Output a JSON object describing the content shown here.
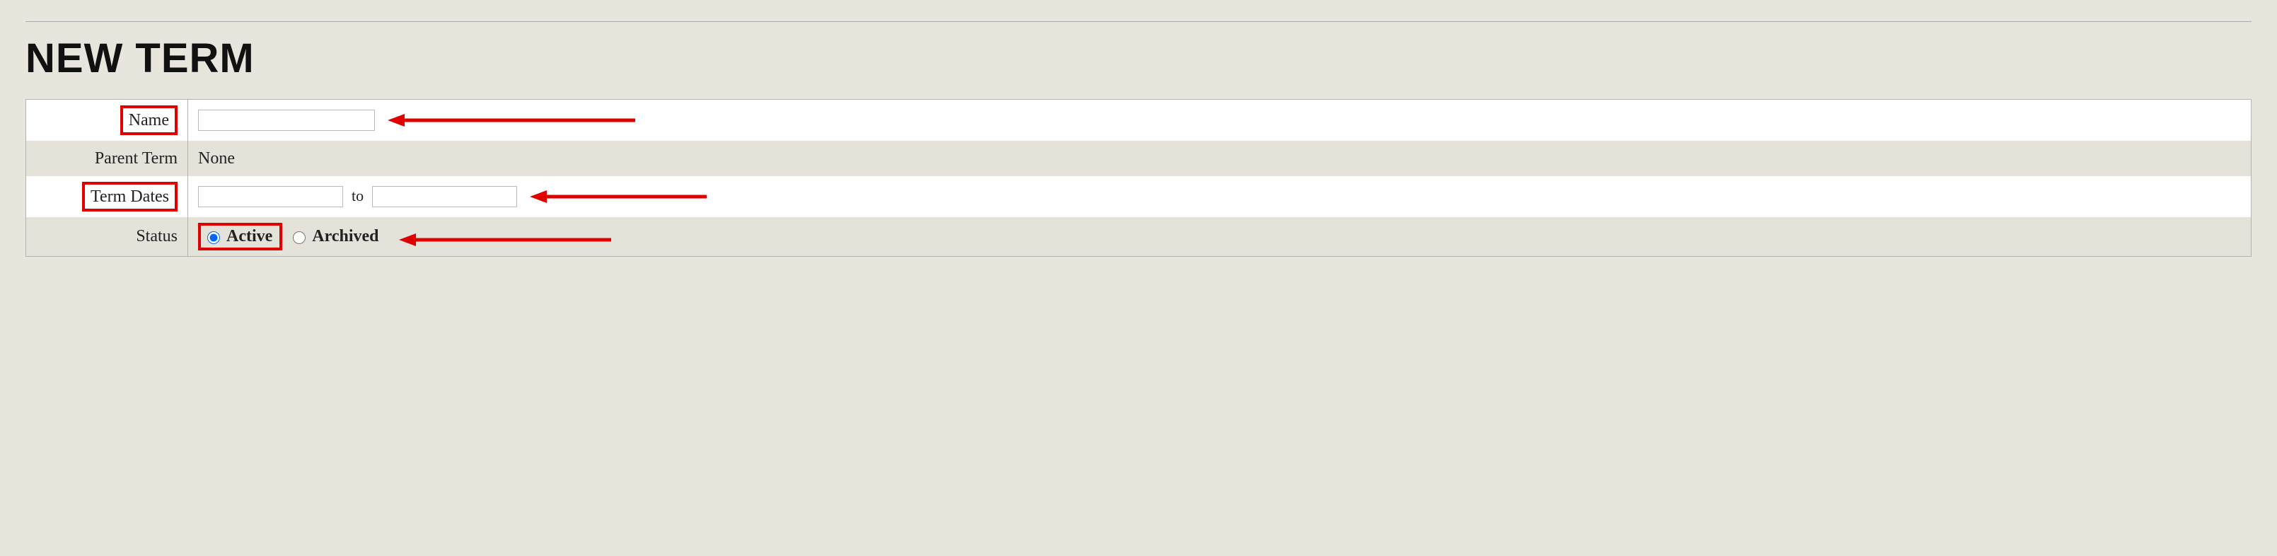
{
  "page_title": "NEW TERM",
  "form": {
    "name": {
      "label": "Name",
      "value": ""
    },
    "parent_term": {
      "label": "Parent Term",
      "value": "None"
    },
    "term_dates": {
      "label": "Term Dates",
      "from": "",
      "to_word": "to",
      "to": ""
    },
    "status": {
      "label": "Status",
      "active_label": "Active",
      "archived_label": "Archived",
      "selected": "active"
    }
  },
  "annotations": {
    "highlight_color": "#e10000"
  }
}
